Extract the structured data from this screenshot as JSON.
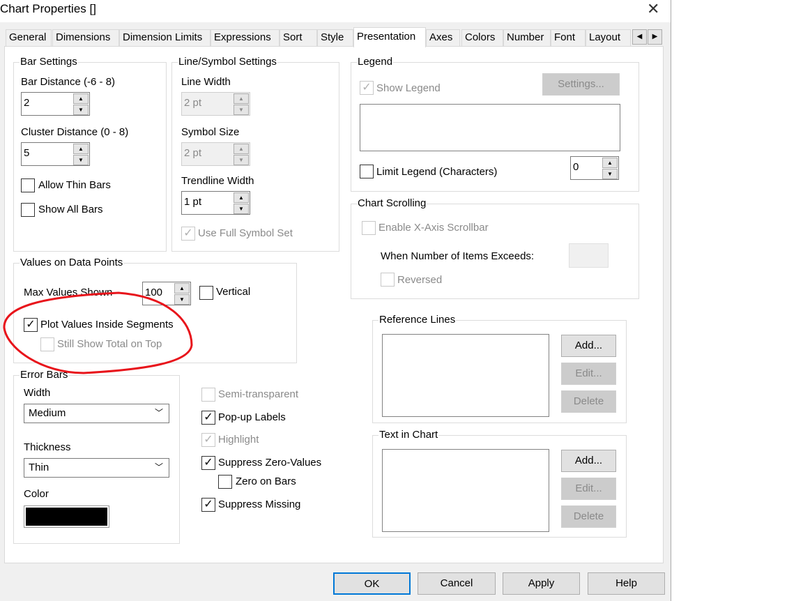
{
  "window": {
    "title": "Chart Properties []",
    "close": "✕"
  },
  "tabs": [
    "General",
    "Dimensions",
    "Dimension Limits",
    "Expressions",
    "Sort",
    "Style",
    "Presentation",
    "Axes",
    "Colors",
    "Number",
    "Font",
    "Layout"
  ],
  "active_tab": "Presentation",
  "bar_settings": {
    "title": "Bar Settings",
    "bar_distance_label": "Bar Distance (-6 - 8)",
    "bar_distance": "2",
    "cluster_distance_label": "Cluster Distance (0 - 8)",
    "cluster_distance": "5",
    "allow_thin_bars": "Allow Thin Bars",
    "show_all_bars": "Show All Bars"
  },
  "line_symbol": {
    "title": "Line/Symbol Settings",
    "line_width_label": "Line Width",
    "line_width": "2 pt",
    "symbol_size_label": "Symbol Size",
    "symbol_size": "2 pt",
    "trendline_width_label": "Trendline Width",
    "trendline_width": "1 pt",
    "use_full_symbol_set": "Use Full Symbol Set"
  },
  "legend": {
    "title": "Legend",
    "show_legend": "Show Legend",
    "settings": "Settings...",
    "limit_legend": "Limit Legend (Characters)",
    "limit_value": "0"
  },
  "chart_scrolling": {
    "title": "Chart Scrolling",
    "enable": "Enable X-Axis Scrollbar",
    "exceeds": "When Number of Items Exceeds:",
    "reversed": "Reversed"
  },
  "values_on_points": {
    "title": "Values on Data Points",
    "max_label": "Max Values Shown",
    "max_value": "100",
    "vertical": "Vertical",
    "plot_inside": "Plot Values Inside Segments",
    "still_show_total": "Still Show Total on Top"
  },
  "error_bars": {
    "title": "Error Bars",
    "width_label": "Width",
    "width_value": "Medium",
    "thickness_label": "Thickness",
    "thickness_value": "Thin",
    "color_label": "Color",
    "color": "#000000"
  },
  "options": {
    "semi_transparent": "Semi-transparent",
    "popup_labels": "Pop-up Labels",
    "highlight": "Highlight",
    "suppress_zero": "Suppress Zero-Values",
    "zero_on_bars": "Zero on Bars",
    "suppress_missing": "Suppress Missing"
  },
  "reference_lines": {
    "title": "Reference Lines",
    "add": "Add...",
    "edit": "Edit...",
    "delete": "Delete"
  },
  "text_in_chart": {
    "title": "Text in Chart",
    "add": "Add...",
    "edit": "Edit...",
    "delete": "Delete"
  },
  "footer": {
    "ok": "OK",
    "cancel": "Cancel",
    "apply": "Apply",
    "help": "Help"
  },
  "annotation_color": "#e8141b"
}
